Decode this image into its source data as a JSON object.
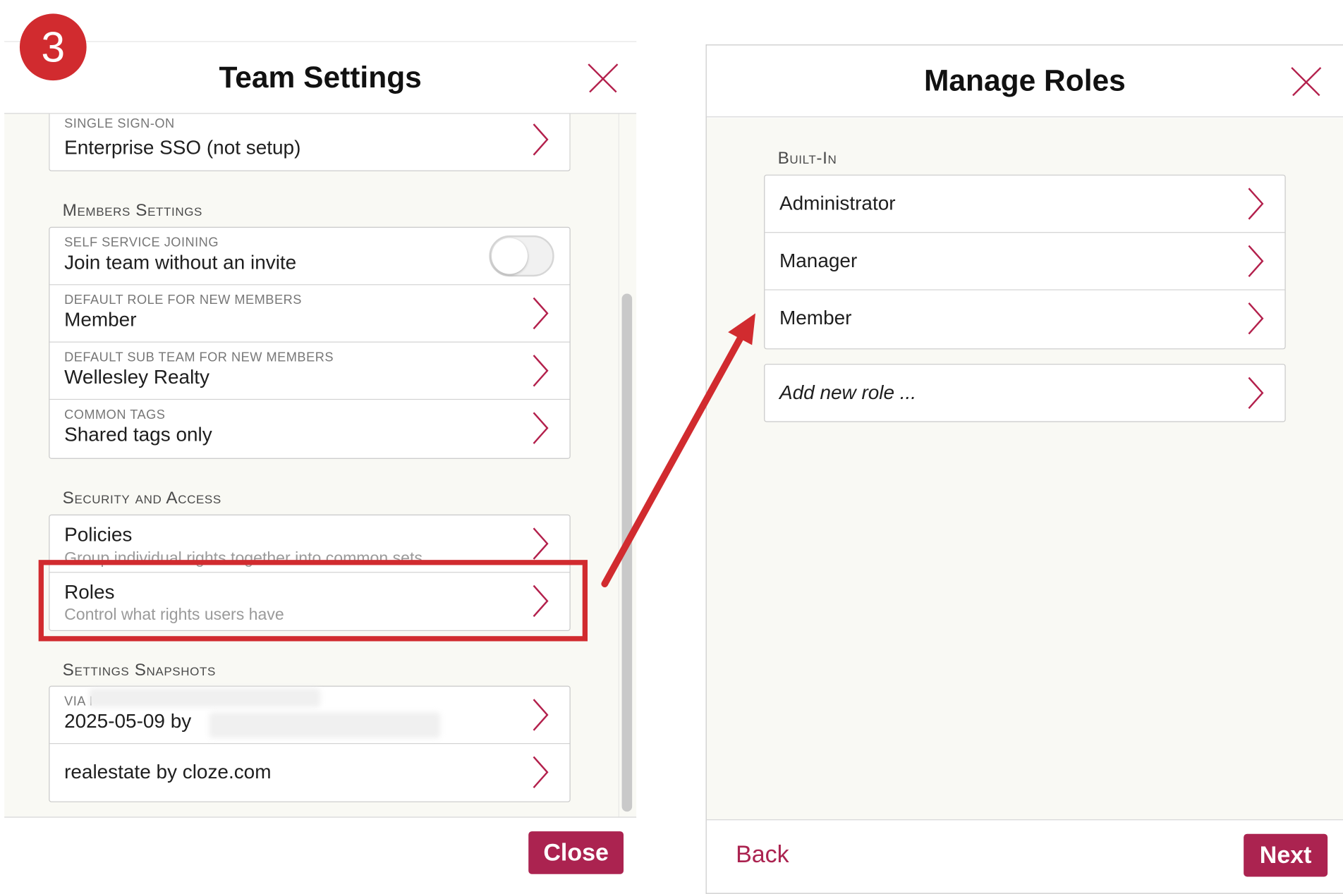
{
  "step_badge": "3",
  "left_panel": {
    "title": "Team Settings",
    "close_label": "Close",
    "sso": {
      "small": "SINGLE SIGN-ON",
      "main": "Enterprise SSO (not setup)"
    },
    "members": {
      "title": "Members Settings",
      "rows": [
        {
          "small": "SELF SERVICE JOINING",
          "main": "Join team without an invite",
          "toggle": false
        },
        {
          "small": "DEFAULT ROLE FOR NEW MEMBERS",
          "main": "Member"
        },
        {
          "small": "DEFAULT SUB TEAM FOR NEW MEMBERS",
          "main": "Wellesley Realty"
        },
        {
          "small": "COMMON TAGS",
          "main": "Shared tags only"
        }
      ]
    },
    "security": {
      "title": "Security and Access",
      "rows": [
        {
          "main": "Policies",
          "sub": "Group individual rights together into common sets"
        },
        {
          "main": "Roles",
          "sub": "Control what rights users have"
        }
      ]
    },
    "snapshots": {
      "title": "Settings Snapshots",
      "rows": [
        {
          "small": "VIA I",
          "main": "2025-05-09 by"
        },
        {
          "main": "realestate by cloze.com"
        }
      ]
    }
  },
  "right_panel": {
    "title": "Manage Roles",
    "builtin_title": "Built-In",
    "roles": [
      "Administrator",
      "Manager",
      "Member"
    ],
    "add_role": "Add new role ...",
    "back_label": "Back",
    "next_label": "Next"
  },
  "colors": {
    "accent": "#ab2350",
    "annotation": "#d12b2f",
    "body_bg": "#f9f9f4"
  },
  "icons": {
    "close": "close-x-icon",
    "chevron": "chevron-right-icon"
  }
}
